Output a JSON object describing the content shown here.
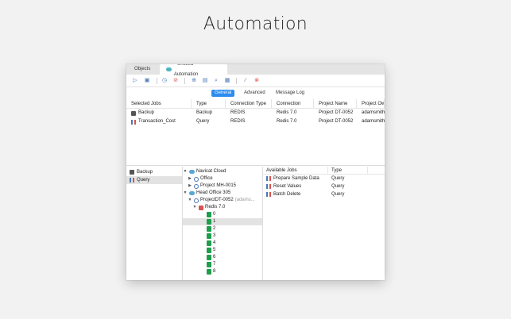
{
  "headline": "Automation",
  "tabs": {
    "objects": "Objects",
    "active": "* Untitled - Automation"
  },
  "toolbar": {
    "icons": [
      "run-icon",
      "save-icon",
      "schedule-icon",
      "cancel-schedule-icon",
      "add-job-icon",
      "edit-job-icon",
      "find-icon",
      "arrange-icon",
      "attach-icon",
      "delete-attachment-icon"
    ]
  },
  "segments": {
    "general": "General",
    "advanced": "Advanced",
    "message_log": "Message Log"
  },
  "jobs_table": {
    "headers": [
      "Selected Jobs",
      "Type",
      "Connection Type",
      "Connection",
      "Project Name",
      "Project Ow"
    ],
    "rows": [
      {
        "job": "Backup",
        "type": "Backup",
        "conn_type": "REDIS",
        "connection": "Redis 7.0",
        "project": "Project DT-0052",
        "owner": "adamsmith"
      },
      {
        "job": "Transaction_Cost",
        "type": "Query",
        "conn_type": "REDIS",
        "connection": "Redis 7.0",
        "project": "Project DT-0052",
        "owner": "adamsmith"
      }
    ]
  },
  "left_pane": [
    "Backup",
    "Query"
  ],
  "tree": {
    "navicat_cloud": "Navicat Cloud",
    "office": "Office",
    "project_mh": "Project MH-0015",
    "head_office": "Head Office 305",
    "project_dt": "ProjectDT-0052",
    "project_dt_owner": "(adams...",
    "redis": "Redis 7.0",
    "dbs": [
      "0",
      "1",
      "2",
      "3",
      "4",
      "5",
      "6",
      "7",
      "8"
    ]
  },
  "available": {
    "headers": [
      "Available Jobs",
      "Type"
    ],
    "rows": [
      {
        "job": "Prepare Sample Data",
        "type": "Query"
      },
      {
        "job": "Reset Values",
        "type": "Query"
      },
      {
        "job": "Batch Delete",
        "type": "Query"
      }
    ]
  }
}
